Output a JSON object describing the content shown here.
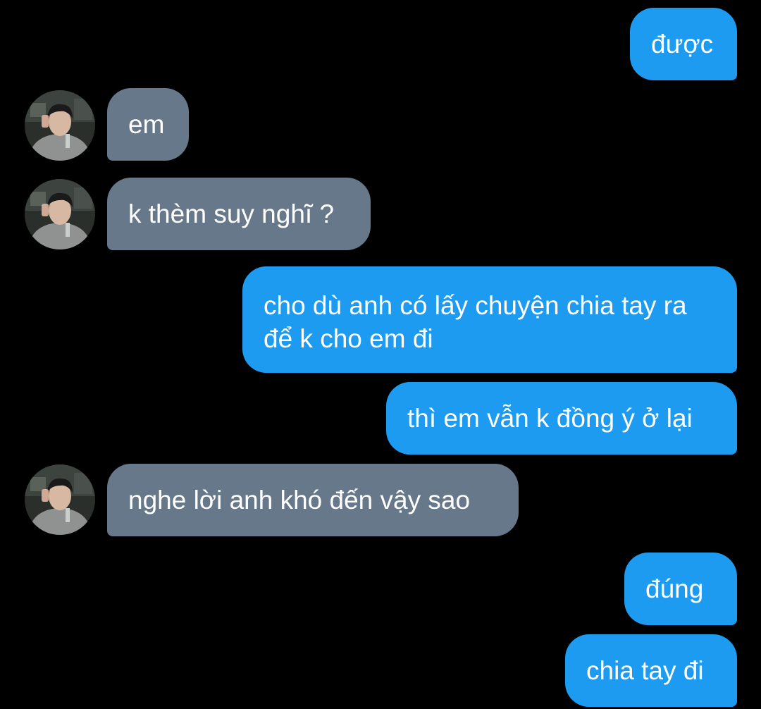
{
  "conversation": {
    "messages": [
      {
        "sender": "me",
        "text": "được"
      },
      {
        "sender": "contact",
        "text": "em"
      },
      {
        "sender": "contact",
        "text": "k thèm suy nghĩ ?"
      },
      {
        "sender": "me",
        "text": "cho dù anh có lấy chuyện chia tay ra để k cho em đi"
      },
      {
        "sender": "me",
        "text": "thì em vẫn k đồng ý ở lại"
      },
      {
        "sender": "contact",
        "text": "nghe lời anh khó đến vậy sao"
      },
      {
        "sender": "me",
        "text": "đúng"
      },
      {
        "sender": "me",
        "text": "chia tay đi"
      }
    ]
  },
  "colors": {
    "background": "#000000",
    "sent_bubble": "#1d9bf0",
    "received_bubble": "#66788a",
    "text": "#ffffff"
  },
  "icons": {
    "avatar": "contact-avatar-photo"
  }
}
